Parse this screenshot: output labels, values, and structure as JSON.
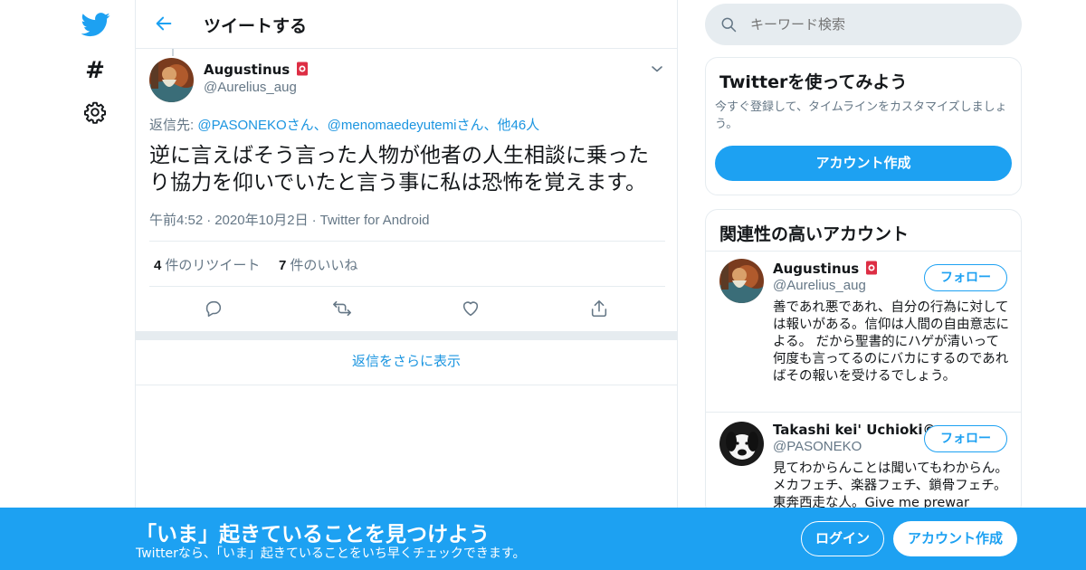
{
  "colors": {
    "accent": "#1da1f2",
    "link": "#1b95e0",
    "text": "#14171a",
    "muted": "#657786",
    "border": "#e6ecf0"
  },
  "nav": {
    "logo_icon": "twitter-bird-icon",
    "explore_icon": "hashtag-icon",
    "settings_icon": "gear-icon"
  },
  "header": {
    "back_icon": "arrow-left-icon",
    "title": "ツイートする"
  },
  "tweet": {
    "author_name": "Augustinus",
    "author_badge_icon": "red-card-emoji-icon",
    "author_handle": "@Aurelius_aug",
    "more_icon": "chevron-down-icon",
    "reply_label": "返信先: ",
    "reply_user1": "@PASONEKO",
    "reply_san1": "さん、",
    "reply_user2": "@menomaedeyutemi",
    "reply_san2": "さん、",
    "reply_others": "他46人",
    "text": "逆に言えばそう言った人物が他者の人生相談に乗ったり協力を仰いでいたと言う事に私は恐怖を覚えます。",
    "time": "午前4:52",
    "dot1": "·",
    "date": "2020年10月2日",
    "dot2": "·",
    "source": "Twitter for Android",
    "retweet_count": "4",
    "retweet_label": "件のリツイート",
    "like_count": "7",
    "like_label": "件のいいね",
    "action_icons": [
      "reply-icon",
      "retweet-icon",
      "heart-icon",
      "share-icon"
    ]
  },
  "show_more": "返信をさらに表示",
  "search": {
    "placeholder": "キーワード検索",
    "icon": "search-icon"
  },
  "signup_card": {
    "title": "Twitterを使ってみよう",
    "description": "今すぐ登録して、タイムラインをカスタマイズしましょう。",
    "button": "アカウント作成"
  },
  "related": {
    "title": "関連性の高いアカウント",
    "accounts": [
      {
        "name": "Augustinus",
        "handle": "@Aurelius_aug",
        "follow": "フォロー",
        "bio": "善であれ悪であれ、自分の行為に対しては報いがある。信仰は人間の自由意志による。 だから聖書的にハゲが清いって何度も言ってるのにバカにするのであればその報いを受けるでしょう。"
      },
      {
        "name": "Takashi kei' Uchioki©",
        "handle": "@PASONEKO",
        "follow": "フォロー",
        "bio": "見てわからんことは聞いてもわからん。メカフェチ、楽器フェチ、鎖骨フェチ。東奔西走な人。Give me prewar"
      }
    ]
  },
  "banner": {
    "title": "「いま」起きていることを見つけよう",
    "subtitle": "Twitterなら、「いま」起きていることをいち早くチェックできます。",
    "login": "ログイン",
    "signup": "アカウント作成"
  }
}
